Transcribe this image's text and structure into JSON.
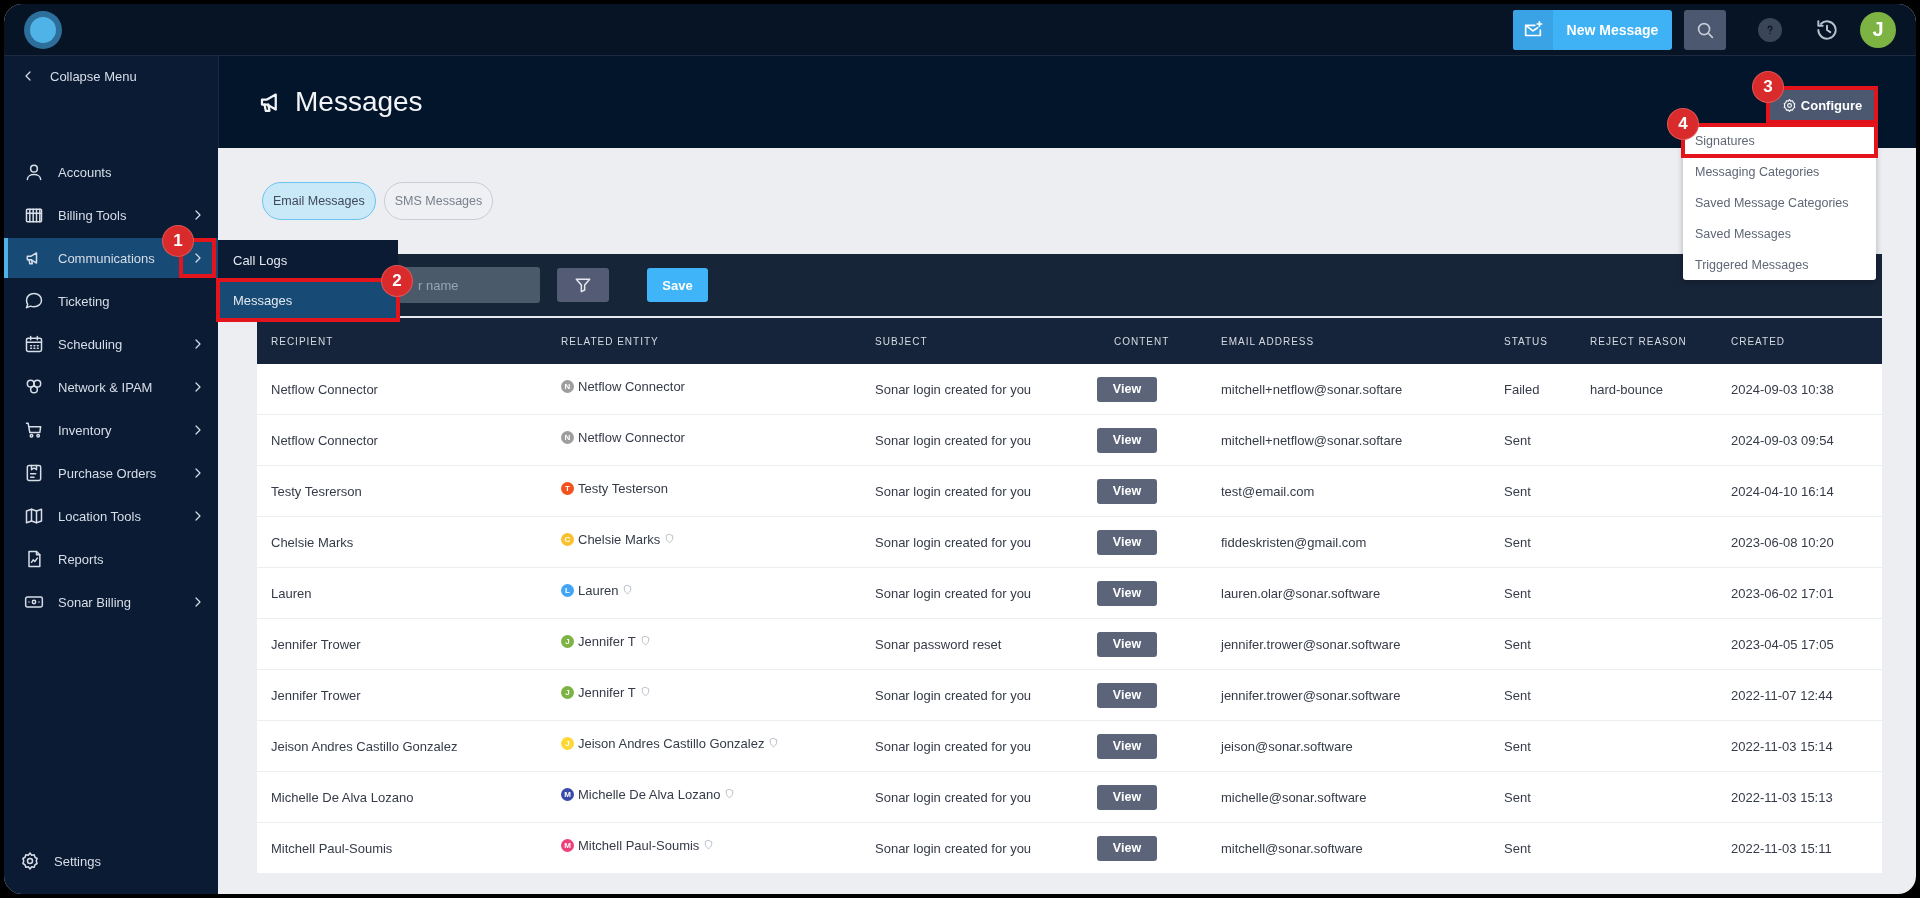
{
  "topbar": {
    "new_message": "New Message",
    "avatar_initial": "J"
  },
  "sidebar": {
    "collapse": "Collapse Menu",
    "items": [
      {
        "label": "Accounts",
        "selected": false,
        "has_submenu": false
      },
      {
        "label": "Billing Tools",
        "selected": false,
        "has_submenu": true
      },
      {
        "label": "Communications",
        "selected": true,
        "has_submenu": true,
        "annotation": "1"
      },
      {
        "label": "Ticketing",
        "selected": false,
        "has_submenu": false
      },
      {
        "label": "Scheduling",
        "selected": false,
        "has_submenu": true
      },
      {
        "label": "Network & IPAM",
        "selected": false,
        "has_submenu": true
      },
      {
        "label": "Inventory",
        "selected": false,
        "has_submenu": true
      },
      {
        "label": "Purchase Orders",
        "selected": false,
        "has_submenu": true
      },
      {
        "label": "Location Tools",
        "selected": false,
        "has_submenu": true
      },
      {
        "label": "Reports",
        "selected": false,
        "has_submenu": false
      },
      {
        "label": "Sonar Billing",
        "selected": false,
        "has_submenu": true
      }
    ],
    "settings": "Settings"
  },
  "flyout": {
    "items": [
      {
        "label": "Call Logs",
        "selected": false
      },
      {
        "label": "Messages",
        "selected": true,
        "annotation": "2"
      }
    ]
  },
  "page": {
    "title": "Messages",
    "configure": {
      "label": "Configure",
      "annotation": "3"
    }
  },
  "configure_menu": {
    "items": [
      {
        "label": "Signatures",
        "annotation": "4"
      },
      {
        "label": "Messaging Categories"
      },
      {
        "label": "Saved Message Categories"
      },
      {
        "label": "Saved Messages"
      },
      {
        "label": "Triggered Messages"
      }
    ]
  },
  "tabs": [
    {
      "label": "Email Messages",
      "selected": true
    },
    {
      "label": "SMS Messages",
      "selected": false
    }
  ],
  "toolbar": {
    "search_placeholder": "r name",
    "save": "Save"
  },
  "table": {
    "columns": [
      "RECIPIENT",
      "RELATED ENTITY",
      "SUBJECT",
      "CONTENT",
      "EMAIL ADDRESS",
      "STATUS",
      "REJECT REASON",
      "CREATED"
    ],
    "rows": [
      {
        "recipient": "Netflow Connector",
        "entity": {
          "initial": "N",
          "name": "Netflow Connector",
          "color": "#9e9e9e",
          "shield": false
        },
        "subject": "Sonar login created for you",
        "content": "View",
        "email": "mitchell+netflow@sonar.softare",
        "status": "Failed",
        "reject_reason": "hard-bounce",
        "created": "2024-09-03 10:38"
      },
      {
        "recipient": "Netflow Connector",
        "entity": {
          "initial": "N",
          "name": "Netflow Connector",
          "color": "#9e9e9e",
          "shield": false
        },
        "subject": "Sonar login created for you",
        "content": "View",
        "email": "mitchell+netflow@sonar.softare",
        "status": "Sent",
        "created": "2024-09-03 09:54"
      },
      {
        "recipient": "Testy Tesrerson",
        "entity": {
          "initial": "T",
          "name": "Testy Testerson",
          "color": "#f4511e",
          "shield": false
        },
        "subject": "Sonar login created for you",
        "content": "View",
        "email": "test@email.com",
        "status": "Sent",
        "created": "2024-04-10 16:14"
      },
      {
        "recipient": "Chelsie Marks",
        "entity": {
          "initial": "C",
          "name": "Chelsie Marks",
          "color": "#fbc02d",
          "shield": true
        },
        "subject": "Sonar login created for you",
        "content": "View",
        "email": "fiddeskristen@gmail.com",
        "status": "Sent",
        "created": "2023-06-08 10:20"
      },
      {
        "recipient": "Lauren",
        "entity": {
          "initial": "L",
          "name": "Lauren",
          "color": "#42a5f5",
          "shield": true
        },
        "subject": "Sonar login created for you",
        "content": "View",
        "email": "lauren.olar@sonar.software",
        "status": "Sent",
        "created": "2023-06-02 17:01"
      },
      {
        "recipient": "Jennifer Trower",
        "entity": {
          "initial": "J",
          "name": "Jennifer T",
          "color": "#7cb342",
          "shield": true
        },
        "subject": "Sonar password reset",
        "content": "View",
        "email": "jennifer.trower@sonar.software",
        "status": "Sent",
        "created": "2023-04-05 17:05"
      },
      {
        "recipient": "Jennifer Trower",
        "entity": {
          "initial": "J",
          "name": "Jennifer T",
          "color": "#7cb342",
          "shield": true
        },
        "subject": "Sonar login created for you",
        "content": "View",
        "email": "jennifer.trower@sonar.software",
        "status": "Sent",
        "created": "2022-11-07 12:44"
      },
      {
        "recipient": "Jeison Andres Castillo Gonzalez",
        "entity": {
          "initial": "J",
          "name": "Jeison Andres Castillo Gonzalez",
          "color": "#fdd835",
          "shield": true
        },
        "subject": "Sonar login created for you",
        "content": "View",
        "email": "jeison@sonar.software",
        "status": "Sent",
        "created": "2022-11-03 15:14"
      },
      {
        "recipient": "Michelle De Alva Lozano",
        "entity": {
          "initial": "M",
          "name": "Michelle De Alva Lozano",
          "color": "#3949ab",
          "shield": true
        },
        "subject": "Sonar login created for you",
        "content": "View",
        "email": "michelle@sonar.software",
        "status": "Sent",
        "created": "2022-11-03 15:13"
      },
      {
        "recipient": "Mitchell Paul-Soumis",
        "entity": {
          "initial": "M",
          "name": "Mitchell Paul-Soumis",
          "color": "#ec407a",
          "shield": true
        },
        "subject": "Sonar login created for you",
        "content": "View",
        "email": "mitchell@sonar.software",
        "status": "Sent",
        "created": "2022-11-03 15:11"
      }
    ]
  }
}
